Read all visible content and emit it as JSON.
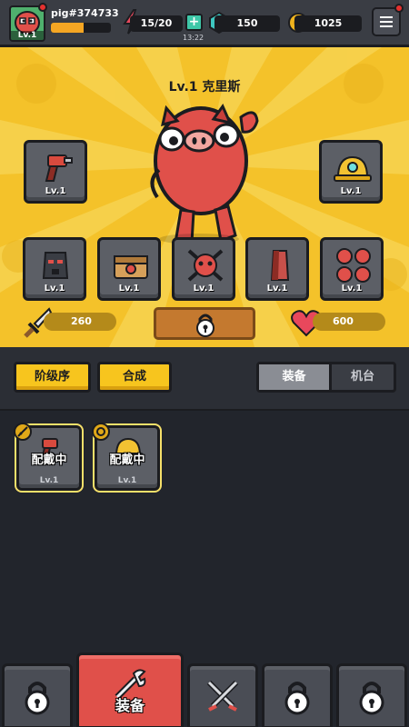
{
  "player": {
    "id": "pig#374733",
    "level": "Lv.1",
    "xp_fraction": 0.55
  },
  "resources": {
    "energy": "15/20",
    "energy_timer": "13:22",
    "gems": "150",
    "coins": "1025"
  },
  "character": {
    "title": "Lv.1 克里斯"
  },
  "equip_slots": {
    "weapon": {
      "icon": "drill-gun-icon",
      "level": "Lv.1"
    },
    "helmet": {
      "icon": "hard-hat-icon",
      "level": "Lv.1"
    },
    "mask": {
      "icon": "gas-mask-icon",
      "level": "Lv.1"
    },
    "chest": {
      "icon": "treasure-chest-icon",
      "level": "Lv.1"
    },
    "emblem": {
      "icon": "pig-skull-emblem-icon",
      "level": "Lv.1"
    },
    "shield": {
      "icon": "shield-icon",
      "level": "Lv.1"
    },
    "pigs": {
      "icon": "pig-faces-icon",
      "level": "Lv.1"
    }
  },
  "stats": {
    "attack": "260",
    "health": "600"
  },
  "filter": {
    "sort_label": "阶级序",
    "merge_label": "合成",
    "tab_equipment": "装备",
    "tab_machine": "机台"
  },
  "inventory": [
    {
      "status": "配戴中",
      "level": "Lv.1",
      "icon": "drill-gun-icon"
    },
    {
      "status": "配戴中",
      "level": "Lv.1",
      "icon": "hard-hat-icon"
    }
  ],
  "nav": {
    "equipment_label": "装备"
  },
  "colors": {
    "accent": "#f4c22a",
    "active_tab": "#e0504a",
    "button_yellow": "#f7c51e"
  }
}
